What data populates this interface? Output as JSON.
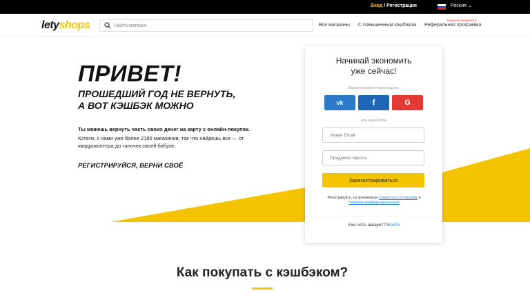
{
  "topbar": {
    "login": "Вход",
    "separator": "/",
    "register": "Регистрация",
    "country": "Россия",
    "flag_colors": [
      "#ffffff",
      "#1e4fc2",
      "#e02020"
    ]
  },
  "header": {
    "logo_part1": "lety",
    "logo_part2": "shops",
    "search_placeholder": "Найти магазин",
    "nav": [
      "Все магазины",
      "С повышенным кэшбэком",
      "Реферальная программа"
    ],
    "nav_badge": "Новые возможности"
  },
  "hero": {
    "title": "ПРИВЕТ!",
    "subtitle_line1": "ПРОШЕДШИЙ ГОД НЕ ВЕРНУТЬ,",
    "subtitle_line2": "А ВОТ КЭШБЭК МОЖНО",
    "text_bold": "Ты можешь вернуть часть своих денег на карту с онлайн-покупок.",
    "text_regular": "Кстати, с нами уже более 2185 магазинов, так что найдешь все — от квадрокоптера до тапочек своей бабуле.",
    "cta": "РЕГИСТРИРУЙСЯ, ВЕРНИ СВОЁ"
  },
  "signup": {
    "title_line1": "Начинай экономить",
    "title_line2": "уже сейчас!",
    "social_hint": "Зарегистрируйся через соцсеть",
    "social": [
      {
        "label": "vk",
        "color": "#2a7ac7"
      },
      {
        "label": "f",
        "color": "#1e66b8"
      },
      {
        "label": "G",
        "color": "#e53935"
      }
    ],
    "email_hint": "или через Email",
    "email_placeholder": "Укажи Email",
    "password_placeholder": "Придумай пароль",
    "submit_label": "Зарегистрироваться",
    "terms_prefix": "Регистрируясь, ты принимаешь",
    "terms_link1": "Клиентское соглашение",
    "terms_and": "и",
    "terms_link2": "Политику конфиденциальности",
    "already_text": "Уже есть аккаунт?",
    "login_link": "Войти"
  },
  "how": {
    "title": "Как покупать с кэшбэком?"
  },
  "colors": {
    "accent": "#f5c400",
    "link": "#1e88e5"
  }
}
